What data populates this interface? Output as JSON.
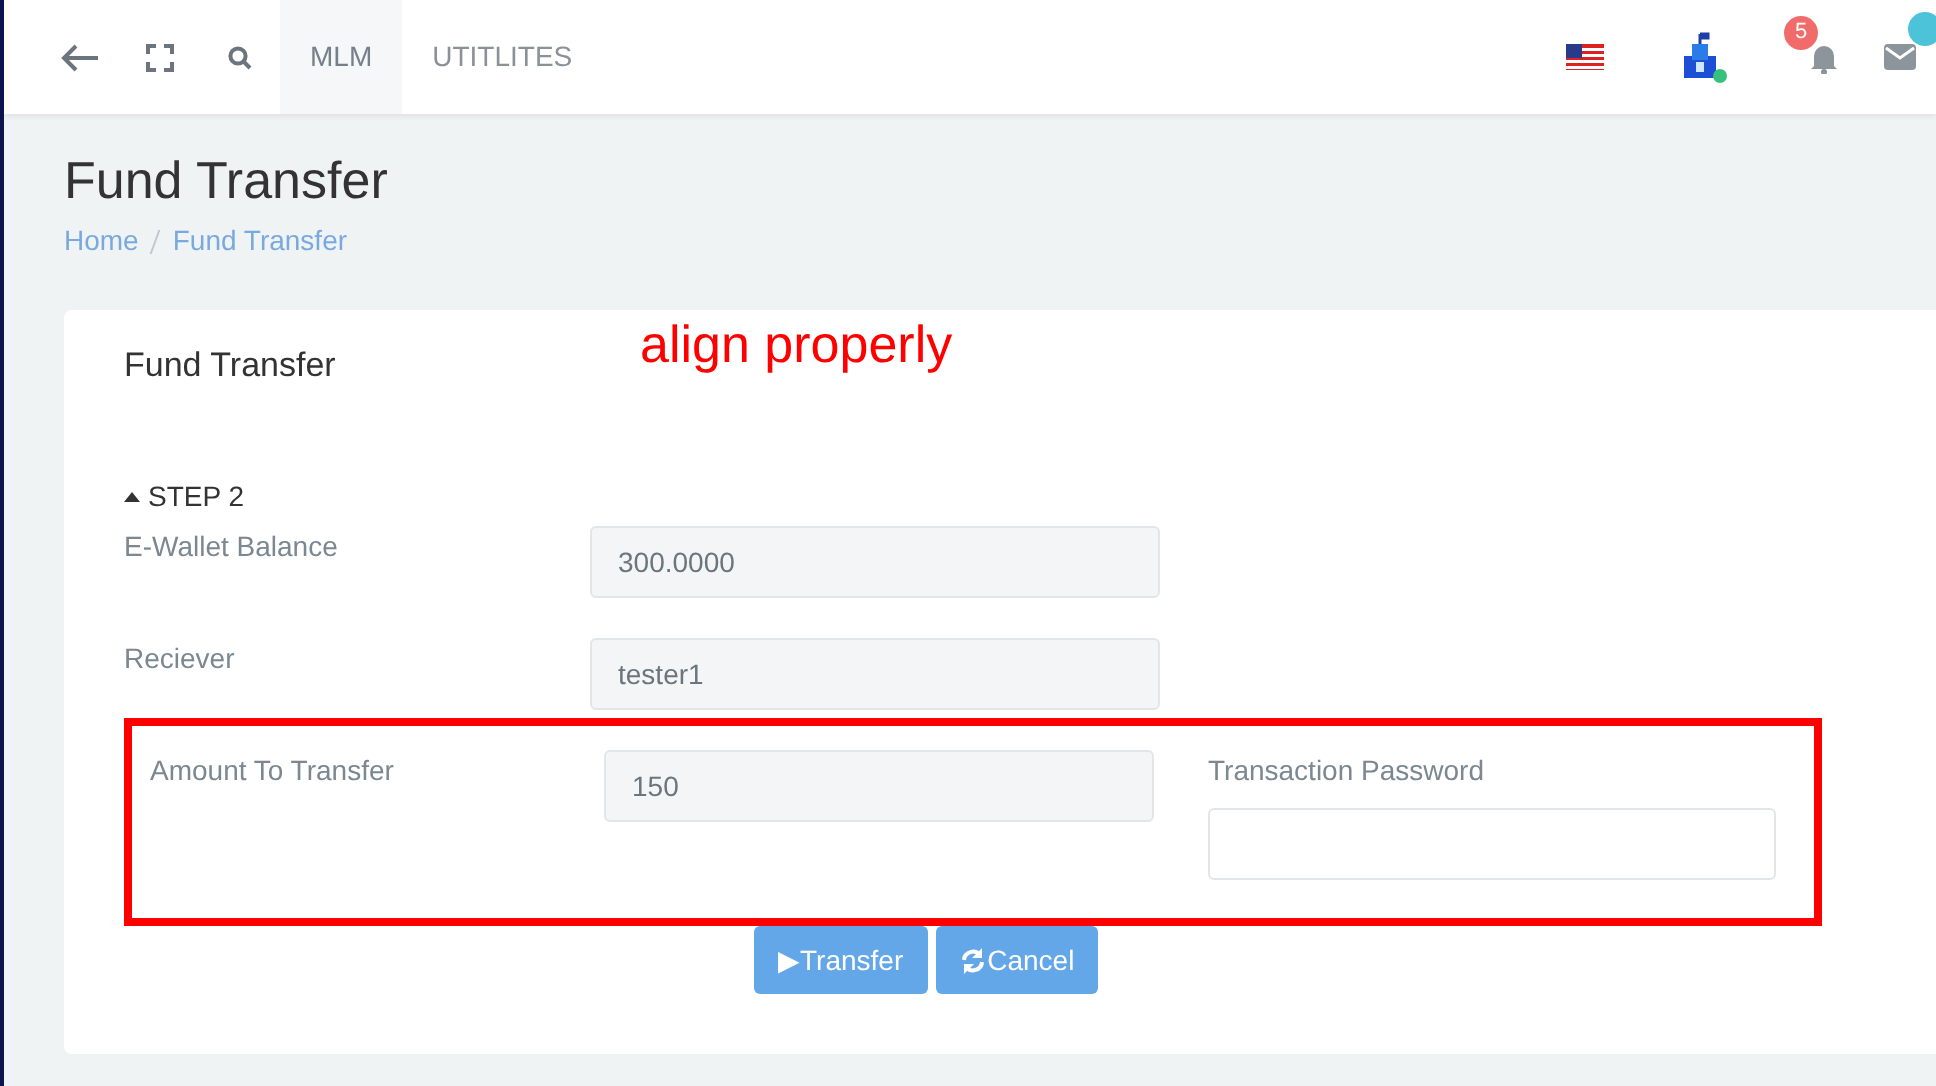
{
  "topbar": {
    "nav_items": [
      {
        "label": "MLM",
        "selected": true
      },
      {
        "label": "UTITLITES",
        "selected": false
      }
    ],
    "notification_count": "5"
  },
  "page": {
    "title": "Fund Transfer",
    "breadcrumb": [
      {
        "label": "Home"
      },
      {
        "label": "Fund Transfer"
      }
    ]
  },
  "card": {
    "title": "Fund Transfer",
    "annotation": "align properly",
    "step": {
      "label": "STEP 2",
      "expanded": true
    },
    "fields": [
      {
        "label": "E-Wallet Balance",
        "value": "300.0000",
        "disabled": true
      },
      {
        "label": "Reciever",
        "value": "tester1",
        "disabled": true
      }
    ],
    "highlighted_row": [
      {
        "label": "Amount To Transfer",
        "value": "150",
        "disabled": true
      },
      {
        "label": "Transaction Password",
        "disabled": false
      }
    ],
    "buttons": [
      {
        "label": "▶Transfer",
        "kind": "submit"
      },
      {
        "label": "Cancel",
        "kind": "cancel"
      }
    ]
  }
}
